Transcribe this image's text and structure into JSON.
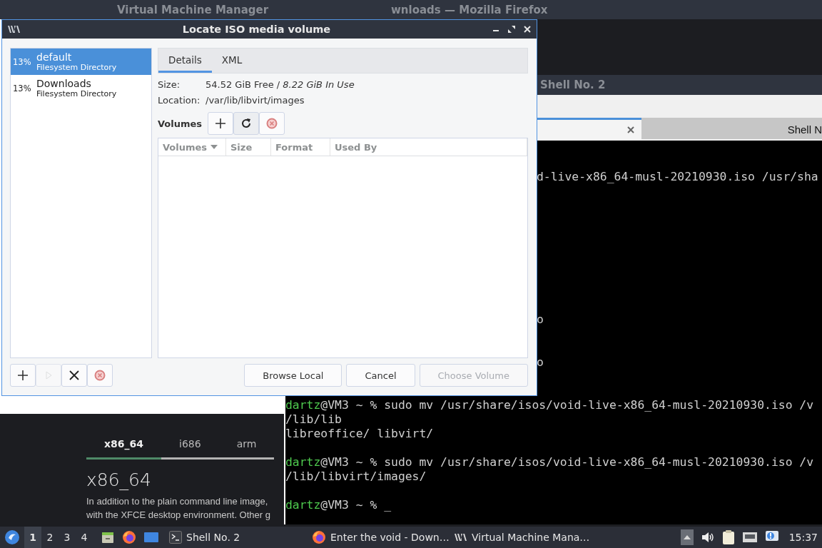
{
  "firefox_window": {
    "title": "wnloads — Mozilla Firefox",
    "tabs": [
      {
        "label": "x86_64",
        "selected": true
      },
      {
        "label": "i686",
        "selected": false
      },
      {
        "label": "arm",
        "selected": false
      }
    ],
    "heading": "x86_64",
    "paragraph": [
      "In addition to the plain command line image,",
      "with the XFCE desktop environment. Other g"
    ]
  },
  "vmm_window": {
    "title": "Virtual Machine Manager"
  },
  "terminal": {
    "title": "Shell No. 2",
    "tabs": [
      {
        "selected": true
      },
      {
        "label": "Shell N",
        "selected": false
      }
    ],
    "lines": [
      {
        "kind": "covered",
        "text": "d-live-x86_64-musl-20210930.iso /usr/sha"
      },
      {
        "kind": "covered",
        "text": "o"
      },
      {
        "kind": "covered",
        "text": "o"
      },
      {
        "kind": "prompt",
        "user": "dartz",
        "text": "@VM3 ~ % sudo mv /usr/share/isos/void-live-x86_64-musl-20210930.iso /v"
      },
      {
        "kind": "output",
        "text": "/lib/lib"
      },
      {
        "kind": "output",
        "text": "libreoffice/ libvirt/"
      },
      {
        "kind": "prompt",
        "user": "dartz",
        "text": "@VM3 ~ % sudo mv /usr/share/isos/void-live-x86_64-musl-20210930.iso /v"
      },
      {
        "kind": "output",
        "text": "/lib/libvirt/images/"
      },
      {
        "kind": "prompt",
        "user": "dartz",
        "text": "@VM3 ~ % _"
      }
    ]
  },
  "dialog": {
    "title": "Locate ISO media volume",
    "pools": [
      {
        "usage": "13%",
        "name": "default",
        "type": "Filesystem Directory",
        "selected": true
      },
      {
        "usage": "13%",
        "name": "Downloads",
        "type": "Filesystem Directory",
        "selected": false
      }
    ],
    "tabs": [
      {
        "label": "Details",
        "selected": true
      },
      {
        "label": "XML",
        "selected": false
      }
    ],
    "size_label": "Size:",
    "size_value": "54.52 GiB Free / *8.22 GiB In Use*",
    "location_label": "Location:",
    "location_value": "/var/lib/libvirt/images",
    "volumes_label": "Volumes",
    "volume_buttons": [
      {
        "kind": "add"
      },
      {
        "kind": "refresh"
      },
      {
        "kind": "delete"
      }
    ],
    "columns": [
      {
        "label": "Volumes",
        "sorted": true
      },
      {
        "label": "Size",
        "sorted": false
      },
      {
        "label": "Format",
        "sorted": false
      },
      {
        "label": "Used By",
        "sorted": false
      }
    ],
    "pool_buttons": [
      {
        "kind": "add",
        "disabled": false
      },
      {
        "kind": "start",
        "disabled": true
      },
      {
        "kind": "stop",
        "disabled": false
      },
      {
        "kind": "delete",
        "disabled": false
      }
    ],
    "buttons": [
      {
        "label": "Browse Local",
        "disabled": false
      },
      {
        "label": "Cancel",
        "disabled": false
      },
      {
        "label": "Choose Volume",
        "disabled": true
      }
    ]
  },
  "taskbar": {
    "workspaces": [
      {
        "label": "1",
        "selected": true
      },
      {
        "label": "2",
        "selected": false
      },
      {
        "label": "3",
        "selected": false
      },
      {
        "label": "4",
        "selected": false
      }
    ],
    "launchers": [
      {
        "kind": "files"
      },
      {
        "kind": "firefox"
      },
      {
        "kind": "desktop"
      }
    ],
    "tasks": [
      {
        "kind": "terminal",
        "label": "Shell No. 2"
      },
      {
        "kind": "firefox",
        "label": "Enter the void - Down…"
      },
      {
        "kind": "vmm",
        "label": "Virtual Machine Mana…"
      }
    ],
    "tray": [
      {
        "kind": "up"
      },
      {
        "kind": "volume"
      },
      {
        "kind": "clipboard"
      },
      {
        "kind": "network"
      },
      {
        "kind": "notification"
      }
    ],
    "clock": "15:37"
  }
}
